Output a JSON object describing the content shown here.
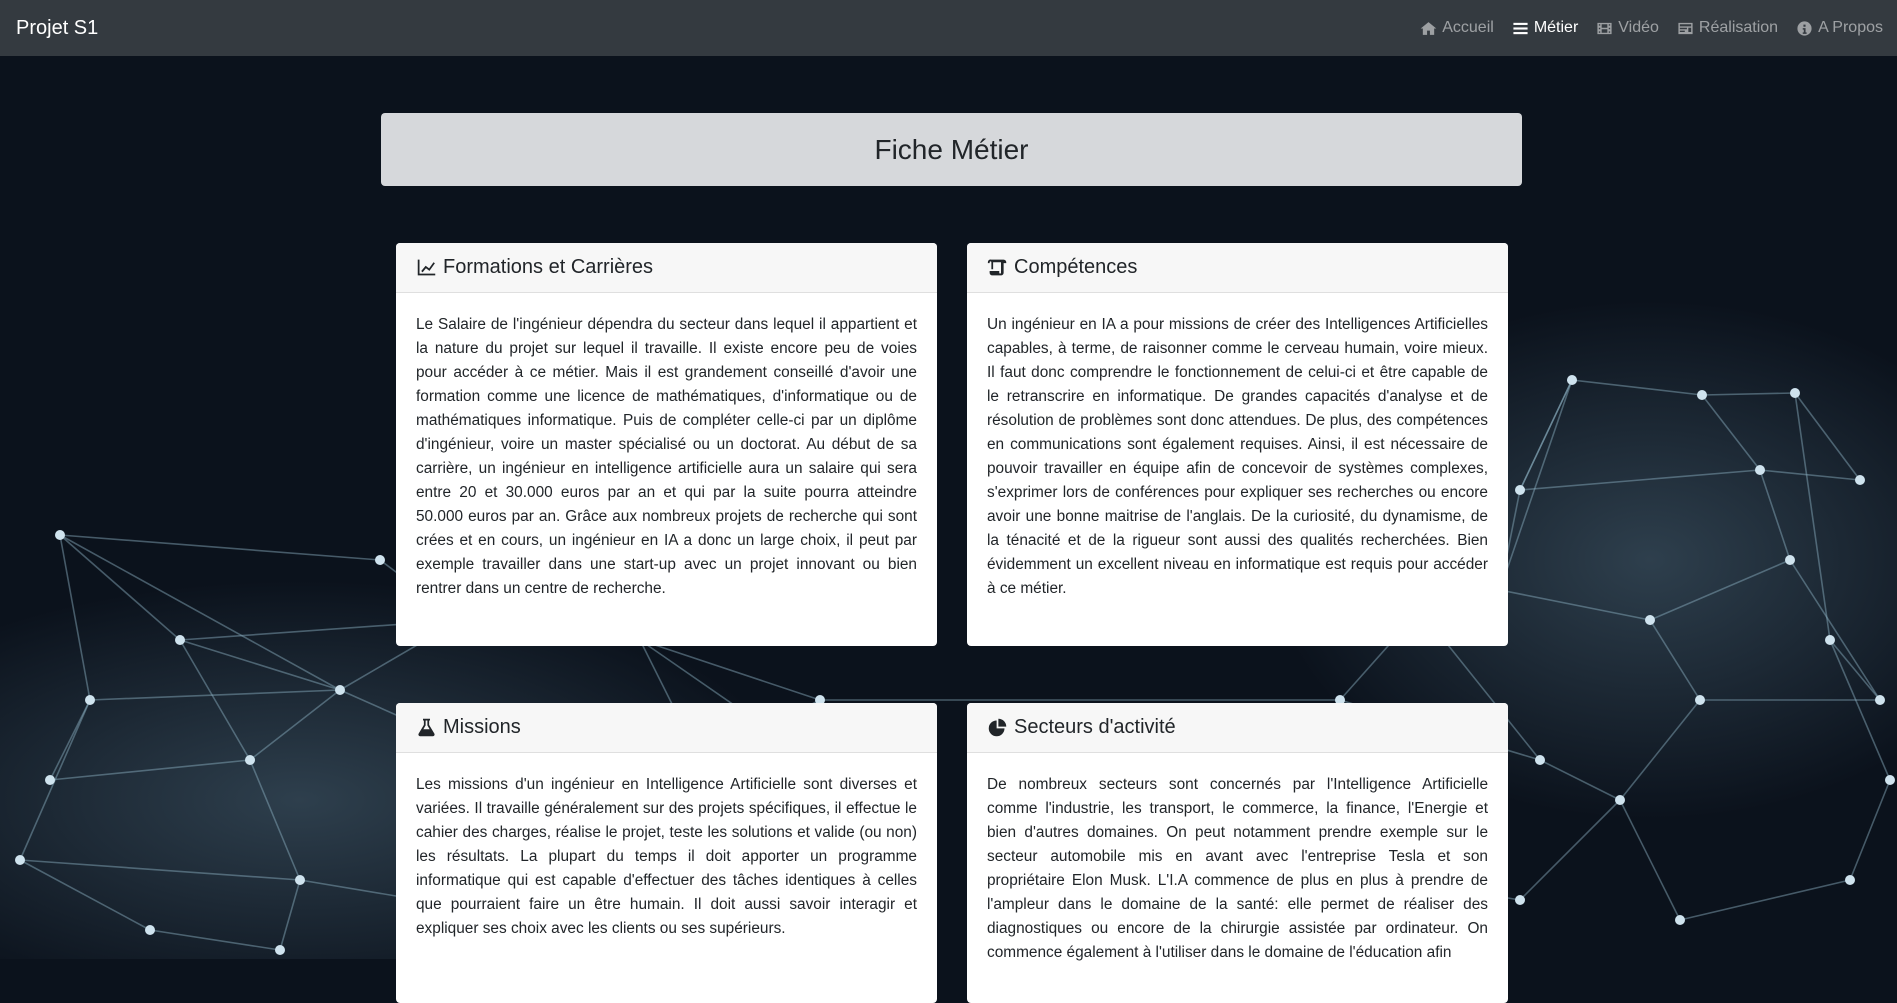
{
  "navbar": {
    "brand": "Projet S1",
    "links": [
      {
        "label": "Accueil",
        "icon": "home-icon",
        "active": false
      },
      {
        "label": "Métier",
        "icon": "list-icon",
        "active": true
      },
      {
        "label": "Vidéo",
        "icon": "film-icon",
        "active": false
      },
      {
        "label": "Réalisation",
        "icon": "id-card-icon",
        "active": false
      },
      {
        "label": "A Propos",
        "icon": "info-icon",
        "active": false
      }
    ]
  },
  "page": {
    "title": "Fiche Métier"
  },
  "cards": {
    "formations": {
      "title": "Formations et Carrières",
      "icon": "chart-line-icon",
      "text": "Le Salaire de l'ingénieur dépendra du secteur dans lequel il appartient et la nature du projet sur lequel il travaille. Il existe encore peu de voies pour accéder à ce métier. Mais il est grandement conseillé d'avoir une formation comme une licence de mathématiques, d'informatique ou de mathématiques informatique. Puis de compléter celle-ci par un diplôme d'ingénieur, voire un master spécialisé ou un doctorat. Au début de sa carrière, un ingénieur en intelligence artificielle aura un salaire qui sera entre 20 et 30.000 euros par an et qui par la suite pourra atteindre 50.000 euros par an. Grâce aux nombreux projets de recherche qui sont crées et en cours, un ingénieur en IA a donc un large choix, il peut par exemple travailler dans une start-up avec un projet innovant ou bien rentrer dans un centre de recherche."
    },
    "competences": {
      "title": "Compétences",
      "icon": "scroll-icon",
      "text": "Un ingénieur en IA a pour missions de créer des Intelligences Artificielles capables, à terme, de raisonner comme le cerveau humain, voire mieux. Il faut donc comprendre le fonctionnement de celui-ci et être capable de le retranscrire en informatique. De grandes capacités d'analyse et de résolution de problèmes sont donc attendues. De plus, des compétences en communications sont également requises. Ainsi, il est nécessaire de pouvoir travailler en équipe afin de concevoir de systèmes complexes, s'exprimer lors de conférences pour expliquer ses recherches ou encore avoir une bonne maitrise de l'anglais. De la curiosité, du dynamisme, de la ténacité et de la rigueur sont aussi des qualités recherchées. Bien évidemment un excellent niveau en informatique est requis pour accéder à ce métier."
    },
    "missions": {
      "title": "Missions",
      "icon": "flask-icon",
      "text": "Les missions d'un ingénieur en Intelligence Artificielle sont diverses et variées. Il travaille généralement sur des projets spécifiques, il effectue le cahier des charges, réalise le projet, teste les solutions et valide (ou non) les résultats. La plupart du temps il doit apporter un programme informatique qui est capable d'effectuer des tâches identiques à celles que pourraient faire un être humain. Il doit aussi savoir interagir et expliquer ses choix avec les clients ou ses supérieurs."
    },
    "secteurs": {
      "title": "Secteurs d'activité",
      "icon": "chart-pie-icon",
      "text": "De nombreux secteurs sont concernés par l'Intelligence Artificielle comme l'industrie, les transport, le commerce, la finance, l'Energie et bien d'autres domaines. On peut notamment prendre exemple sur le secteur automobile mis en avant avec l'entreprise Tesla et son propriétaire Elon Musk. L'I.A commence de plus en plus à prendre de l'ampleur dans le domaine de la santé: elle permet de réaliser des diagnostiques ou encore de la chirurgie assistée par ordinateur. On commence également à l'utiliser dans le domaine de l'éducation afin"
    }
  },
  "colors": {
    "background": "#0b121c",
    "navbar": "#343a40",
    "jumbotron": "#d6d8db",
    "network_lines": "#8fb3c6"
  }
}
